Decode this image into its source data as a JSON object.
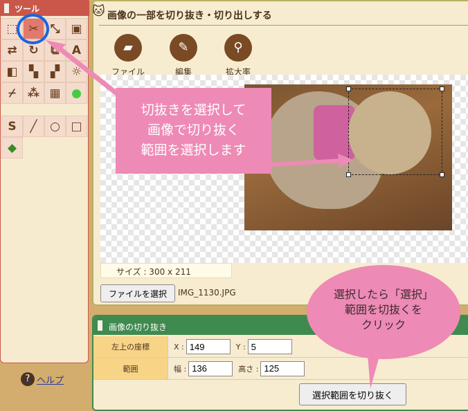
{
  "tools": {
    "title": "ツール",
    "help": "ヘルプ",
    "help_icon": "?",
    "items": [
      "select-rect",
      "scissors",
      "resize",
      "crop-frame",
      "flip",
      "rotate",
      "add-layer",
      "text",
      "contrast",
      "grayscale",
      "blur",
      "brightness",
      "eyedropper",
      "sparkle",
      "mosaic",
      "glow",
      "curve",
      "line",
      "circle",
      "rectangle",
      "eraser"
    ]
  },
  "main": {
    "title": "画像の一部を切り抜き・切り出しする",
    "toolbar": [
      {
        "label": "ファイル",
        "icon": "folder-icon"
      },
      {
        "label": "編集",
        "icon": "pencil-icon"
      },
      {
        "label": "拡大率",
        "icon": "magnifier-icon"
      }
    ],
    "size_label": "サイズ : 300 x 211",
    "file_button": "ファイルを選択",
    "file_name": "IMG_1130.JPG"
  },
  "crop": {
    "title": "画像の切り抜き",
    "coord_label": "左上の座標",
    "x_label": "X :",
    "x_value": "149",
    "y_label": "Y :",
    "y_value": "5",
    "range_label": "範囲",
    "w_label": "幅 :",
    "w_value": "136",
    "h_label": "高さ :",
    "h_value": "125",
    "button": "選択範囲を切り抜く"
  },
  "annotations": {
    "callout": "切抜きを選択して\n画像で切り抜く\n範囲を選択します",
    "bubble": "選択したら「選択」\n範囲を切抜くを\nクリック",
    "accent": "#ee8ab6",
    "ring_color": "#1e64e0"
  }
}
